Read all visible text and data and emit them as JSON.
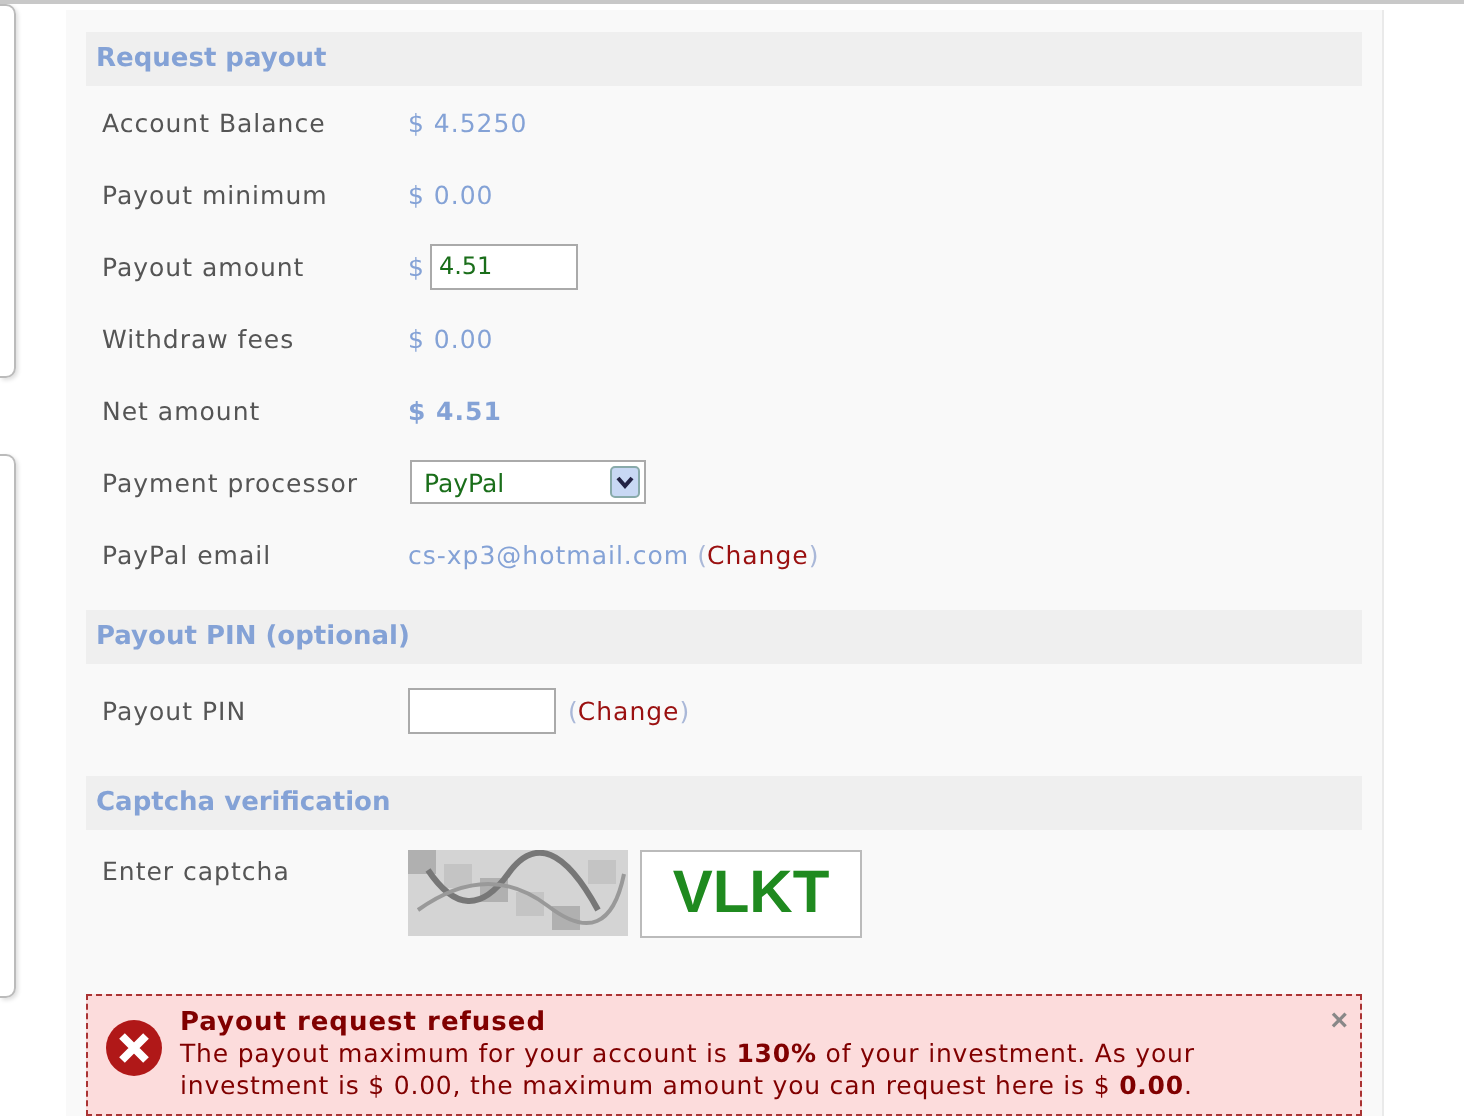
{
  "sections": [
    {
      "title": "Request payout",
      "rows": [
        {
          "kind": "text",
          "label": "Account Balance",
          "value": "$ 4.5250"
        },
        {
          "kind": "text",
          "label": "Payout minimum",
          "value": "$ 0.00"
        },
        {
          "kind": "input",
          "label": "Payout amount",
          "prefix": "$",
          "value": "4.51"
        },
        {
          "kind": "text",
          "label": "Withdraw fees",
          "value": "$ 0.00"
        },
        {
          "kind": "strong",
          "label": "Net amount",
          "value": "$ 4.51"
        },
        {
          "kind": "select",
          "label": "Payment processor",
          "value": "PayPal"
        },
        {
          "kind": "link",
          "label": "PayPal email",
          "value": "cs-xp3@hotmail.com",
          "open": "(",
          "link": "Change",
          "close": ")"
        }
      ]
    },
    {
      "title": "Payout PIN (optional)",
      "rows": [
        {
          "kind": "pin",
          "label": "Payout PIN",
          "open": "(",
          "link": "Change",
          "close": ")"
        }
      ]
    },
    {
      "title": "Captcha verification",
      "rows": [
        {
          "kind": "captcha",
          "label": "Enter captcha",
          "value": "VLKT"
        }
      ]
    }
  ],
  "alert": {
    "title": "Payout request refused",
    "message": "The payout maximum for your account is **130%** of your investment. As your investment is $ 0.00, the maximum amount you can request here is $ **0.00**.",
    "close": "×"
  }
}
